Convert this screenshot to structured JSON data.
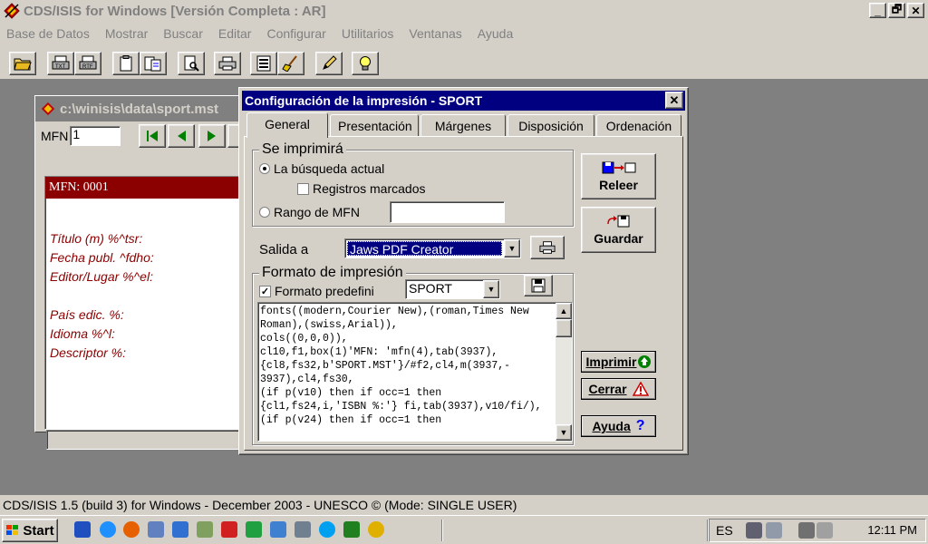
{
  "app": {
    "title": "CDS/ISIS for Windows [Versión Completa : AR]",
    "window_buttons": [
      "_",
      "🗗",
      "✕"
    ]
  },
  "menu": [
    "Base de Datos",
    "Mostrar",
    "Buscar",
    "Editar",
    "Configurar",
    "Utilitarios",
    "Ventanas",
    "Ayuda"
  ],
  "dbwindow": {
    "title": "c:\\winisis\\data\\sport.mst",
    "mfn_label": "MFN",
    "mfn_value": "1",
    "record_header": "MFN: 0001",
    "fields": [
      "Título (m) %^tsr:",
      "Fecha publ. ^fdho:",
      "Editor/Lugar %^el:",
      "",
      "País edic. %:",
      "Idioma %^l:",
      "Descriptor %:"
    ]
  },
  "dialog": {
    "title": "Configuración de la impresión - SPORT",
    "close": "✕",
    "tabs": [
      "General",
      "Presentación",
      "Márgenes",
      "Disposición",
      "Ordenación"
    ],
    "print_group": "Se imprimirá",
    "opt_current_search": "La búsqueda actual",
    "opt_marked": "Registros marcados",
    "opt_range": "Rango de MFN",
    "range_value": "",
    "output_label": "Salida a",
    "output_value": "Jaws PDF Creator",
    "format_group": "Formato de impresión",
    "format_predefined": "Formato predefini",
    "format_value": "SPORT",
    "format_text": "fonts((modern,Courier New),(roman,Times New\nRoman),(swiss,Arial)),\ncols((0,0,0)),\ncl10,f1,box(1)'MFN: 'mfn(4),tab(3937),\n{cl8,fs32,b'SPORT.MST'}/#f2,cl4,m(3937,-\n3937),cl4,fs30,\n(if p(v10) then if occ=1 then\n{cl1,fs24,i,'ISBN %:'} fi,tab(3937),v10/fi/),\n(if p(v24) then if occ=1 then",
    "btn_reload": "Releer",
    "btn_save": "Guardar",
    "btn_print": "Imprimir",
    "btn_close": "Cerrar",
    "btn_help": "Ayuda"
  },
  "status": "CDS/ISIS 1.5 (build 3) for Windows - December 2003 - UNESCO © (Mode: SINGLE USER)",
  "taskbar": {
    "start": "Start",
    "lang": "ES",
    "clock": "12:11 PM"
  },
  "colors": {
    "title_active": "#000080",
    "record_header": "#8b0000",
    "field_text": "#8b0000",
    "face": "#d4d0c8",
    "desktop": "#808080"
  }
}
